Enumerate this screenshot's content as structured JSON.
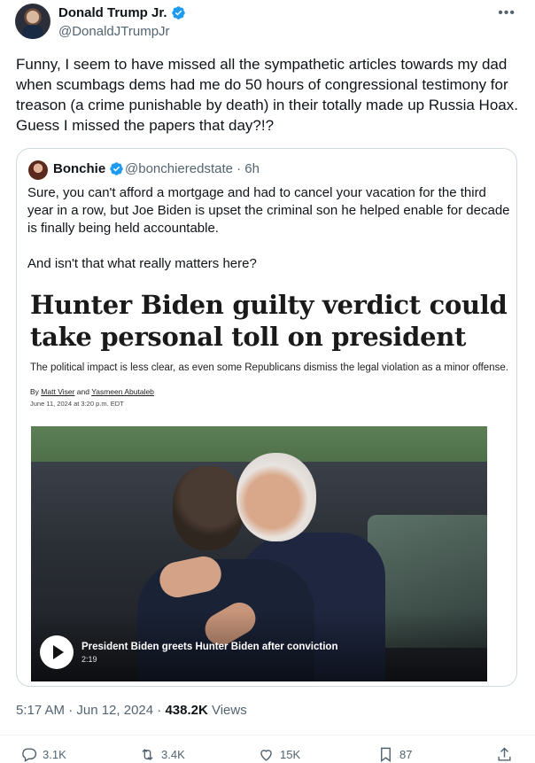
{
  "author": {
    "name": "Donald Trump Jr.",
    "handle": "@DonaldJTrumpJr",
    "verified_color": "#1d9bf0"
  },
  "more_icon": "more-horizontal-icon",
  "tweet": {
    "text": "Funny, I seem to have missed all the sympathetic articles towards my dad when scumbags dems had me do 50 hours of congressional testimony for treason (a crime punishable by death) in their totally made up Russia Hoax. Guess I missed the papers that day?!?"
  },
  "quote": {
    "author_name": "Bonchie",
    "handle_time": "@bonchieredstate · 6h",
    "text": "Sure, you can't afford a mortgage and had to cancel your vacation for the third year in a row, but Joe Biden is upset the criminal son he helped enable for decade is finally being held accountable.\n\nAnd isn't that what really matters here?",
    "article": {
      "headline": "Hunter Biden guilty verdict could take personal toll on president",
      "subhead": "The political impact is less clear, as even some Republicans dismiss the legal violation as a minor offense.",
      "byline_prefix": "By",
      "author_1": "Matt Viser",
      "byline_and": "and",
      "author_2": "Yasmeen Abutaleb",
      "dateline": "June 11, 2024 at 3:20 p.m. EDT"
    },
    "video": {
      "caption": "President Biden greets Hunter Biden after conviction",
      "duration": "2:19",
      "play_icon": "play-icon"
    }
  },
  "meta": {
    "timestamp": "5:17 AM · Jun 12, 2024 · ",
    "views_count": "438.2K",
    "views_label": " Views"
  },
  "actions": {
    "replies": "3.1K",
    "reposts": "3.4K",
    "likes": "15K",
    "bookmarks": "87"
  }
}
